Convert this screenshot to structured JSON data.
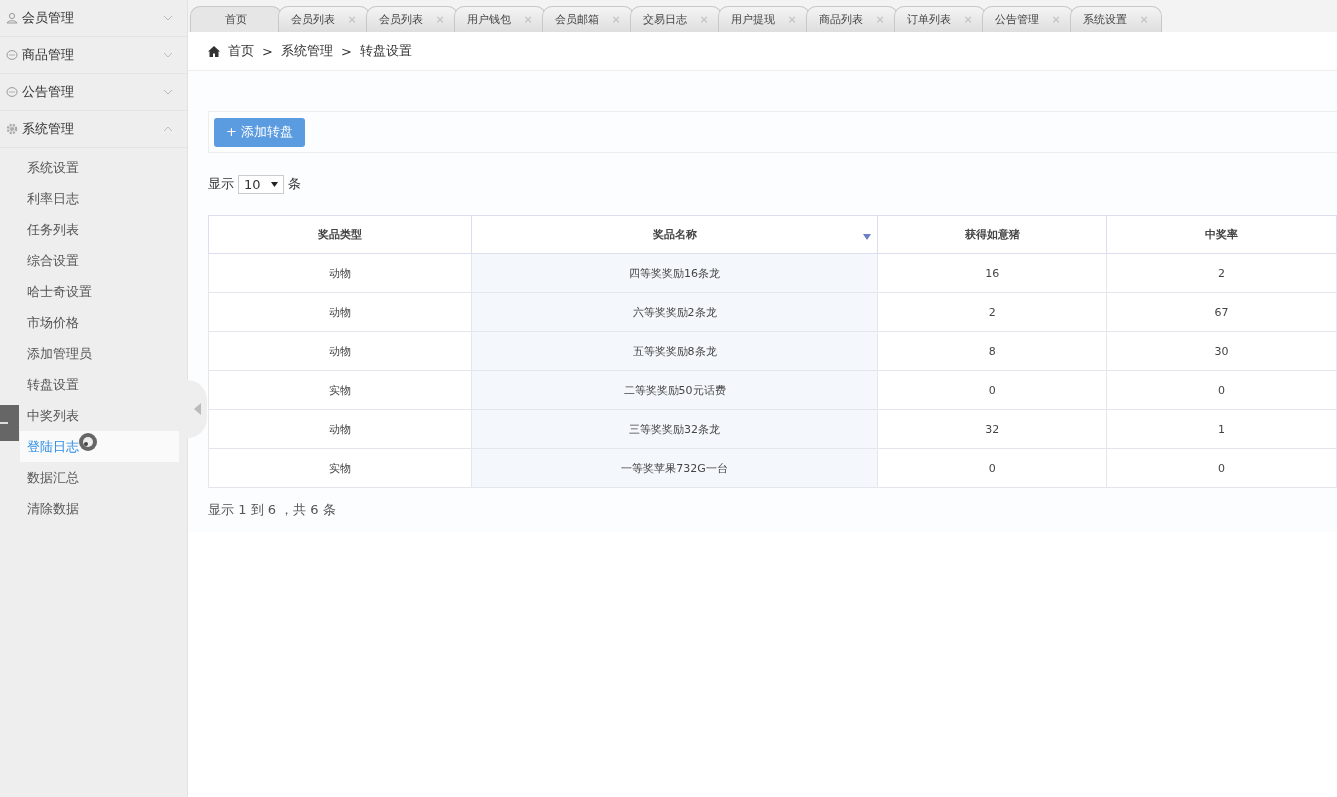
{
  "sidebar": {
    "groups": [
      {
        "label": "会员管理",
        "kind": "user",
        "expanded": false
      },
      {
        "label": "商品管理",
        "kind": "chat",
        "expanded": false
      },
      {
        "label": "公告管理",
        "kind": "chat",
        "expanded": false
      },
      {
        "label": "系统管理",
        "kind": "gear",
        "expanded": true,
        "children": [
          {
            "label": "系统设置",
            "selected": false
          },
          {
            "label": "利率日志",
            "selected": false
          },
          {
            "label": "任务列表",
            "selected": false
          },
          {
            "label": "综合设置",
            "selected": false
          },
          {
            "label": "哈士奇设置",
            "selected": false
          },
          {
            "label": "市场价格",
            "selected": false
          },
          {
            "label": "添加管理员",
            "selected": false
          },
          {
            "label": "转盘设置",
            "selected": false
          },
          {
            "label": "中奖列表",
            "selected": false
          },
          {
            "label": "登陆日志",
            "selected": true
          },
          {
            "label": "数据汇总",
            "selected": false
          },
          {
            "label": "清除数据",
            "selected": false
          }
        ]
      }
    ]
  },
  "tabs": [
    {
      "label": "首页",
      "selected": true
    },
    {
      "label": "会员列表",
      "close": "×",
      "selected": false
    },
    {
      "label": "会员列表",
      "close": "×",
      "selected": false
    },
    {
      "label": "用户钱包",
      "close": "×",
      "selected": false
    },
    {
      "label": "会员邮箱",
      "close": "×",
      "selected": false
    },
    {
      "label": "交易日志",
      "close": "×",
      "selected": false
    },
    {
      "label": "用户提现",
      "close": "×",
      "selected": false
    },
    {
      "label": "商品列表",
      "close": "×",
      "selected": false
    },
    {
      "label": "订单列表",
      "close": "×",
      "selected": false
    },
    {
      "label": "公告管理",
      "close": "×",
      "selected": false
    },
    {
      "label": "系统设置",
      "close": "×",
      "selected": false
    }
  ],
  "breadcrumb": [
    "首页",
    "系统管理",
    "转盘设置"
  ],
  "breadcrumb_separator": ">",
  "add_button": "+ 添加转盘",
  "page_size": {
    "prefix": "显示",
    "value": "10",
    "suffix": "条"
  },
  "table": {
    "columns": [
      {
        "label": "奖品类型",
        "sorted": false
      },
      {
        "label": "奖品名称",
        "sorted": true
      },
      {
        "label": "获得如意猪",
        "sorted": false
      },
      {
        "label": "中奖率",
        "sorted": false
      }
    ],
    "rows": [
      [
        "动物",
        "四等奖奖励16条龙",
        "16",
        "2"
      ],
      [
        "动物",
        "六等奖奖励2条龙",
        "2",
        "67"
      ],
      [
        "动物",
        "五等奖奖励8条龙",
        "8",
        "30"
      ],
      [
        "实物",
        "二等奖奖励50元话费",
        "0",
        "0"
      ],
      [
        "动物",
        "三等奖奖励32条龙",
        "32",
        "1"
      ],
      [
        "实物",
        "一等奖苹果732G一台",
        "0",
        "0"
      ]
    ]
  },
  "table_info": "显示 1 到 6 ，共 6 条"
}
